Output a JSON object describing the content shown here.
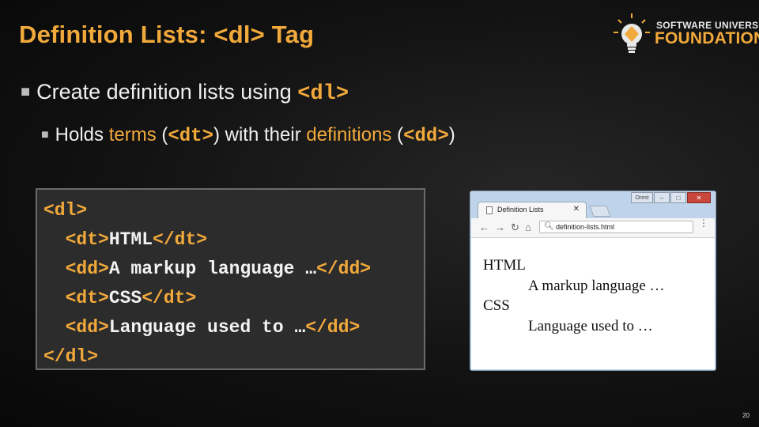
{
  "slide": {
    "title": "Definition Lists: <dl> Tag",
    "number": "20"
  },
  "logo": {
    "line1": "SOFTWARE UNIVERSITY",
    "line2": "FOUNDATION"
  },
  "bullets": {
    "b1_text": "Create definition lists using ",
    "b1_code": "<dl>",
    "b2_a": "Holds ",
    "b2_terms": "terms",
    "b2_b": " (",
    "b2_code1": "<dt>",
    "b2_c": ") with their ",
    "b2_definitions": "definitions",
    "b2_d": " (",
    "b2_code2": "<dd>",
    "b2_e": ")"
  },
  "code": {
    "l1": "<dl>",
    "l2_open": "<dt>",
    "l2_text": "HTML",
    "l2_close": "</dt>",
    "l3_open": "<dd>",
    "l3_text": "A markup language …",
    "l3_close": "</dd>",
    "l4_open": "<dt>",
    "l4_text": "CSS",
    "l4_close": "</dt>",
    "l5_open": "<dd>",
    "l5_text": "Language used to …",
    "l5_close": "</dd>",
    "l6": "</dl>"
  },
  "browser": {
    "user_button": "Orest",
    "tab_title": "Definition Lists",
    "address": "definition-lists.html",
    "page": {
      "dt1": "HTML",
      "dd1": "A markup language …",
      "dt2": "CSS",
      "dd2": "Language used to …"
    }
  },
  "colors": {
    "accent": "#f2a93b",
    "background": "#121212",
    "code_bg": "#2c2c2c"
  },
  "icons": [
    "lightbulb-logo-icon",
    "page-icon",
    "close-icon",
    "back-arrow-icon",
    "forward-arrow-icon",
    "reload-icon",
    "home-icon",
    "search-icon",
    "menu-icon"
  ]
}
